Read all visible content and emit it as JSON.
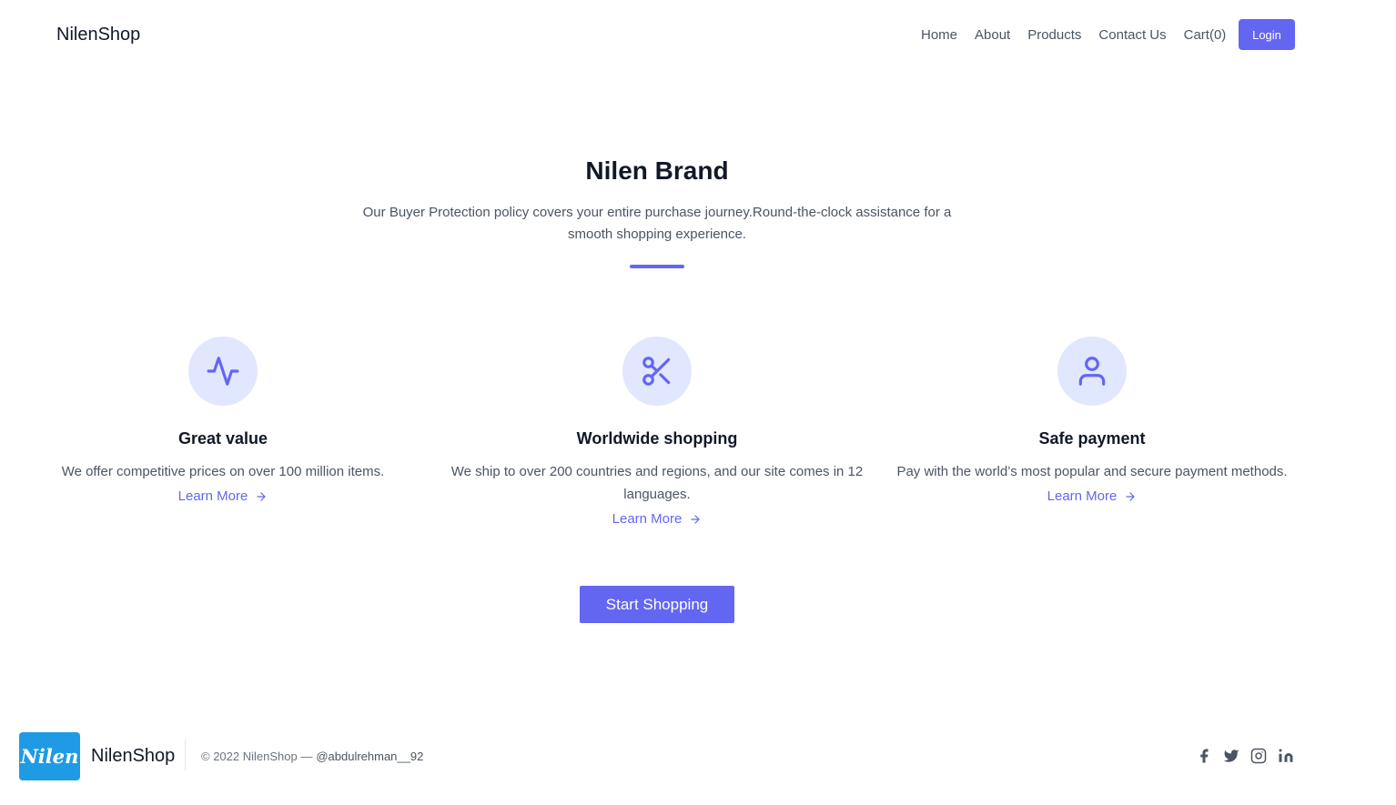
{
  "header": {
    "brand": "NilenShop",
    "nav": [
      "Home",
      "About",
      "Products",
      "Contact Us",
      "Cart(0)"
    ],
    "login_label": "Login"
  },
  "hero": {
    "title": "Nilen Brand",
    "subtitle": "Our Buyer Protection policy covers your entire purchase journey.Round-the-clock assistance for a smooth shopping experience."
  },
  "features": [
    {
      "icon": "activity-icon",
      "title": "Great value",
      "description": "We offer competitive prices on over 100 million items.",
      "link": "Learn More"
    },
    {
      "icon": "scissors-icon",
      "title": "Worldwide shopping",
      "description": "We ship to over 200 countries and regions, and our site comes in 12 languages.",
      "link": "Learn More"
    },
    {
      "icon": "user-icon",
      "title": "Safe payment",
      "description": "Pay with the world’s most popular and secure payment methods.",
      "link": "Learn More"
    }
  ],
  "cta_label": "Start Shopping",
  "footer": {
    "logo_text": "Nilen",
    "brand": "NilenShop",
    "copyright": "© 2022 NilenShop —",
    "handle": "@abdulrehman__92",
    "socials": [
      "facebook-icon",
      "twitter-icon",
      "instagram-icon",
      "linkedin-icon"
    ]
  },
  "colors": {
    "accent": "#6366f1",
    "accent_light": "#e0e7ff",
    "logo_bg": "#1f9be6"
  }
}
